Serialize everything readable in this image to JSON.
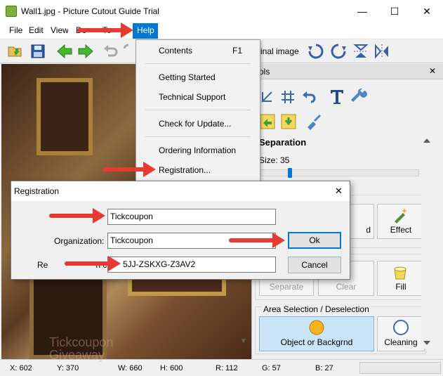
{
  "window": {
    "title": "Wall1.jpg - Picture Cutout Guide Trial",
    "minimize": "—",
    "maximize": "☐",
    "close": "✕"
  },
  "menubar": {
    "items": [
      "File",
      "Edit",
      "View",
      "Document",
      "Tools",
      "Help"
    ]
  },
  "toolbar": {
    "label": "inal image"
  },
  "tools_panel": {
    "header": "ols",
    "close": "✕",
    "separation_title": "Separation",
    "size_label": "Size: 35",
    "size_value": 35,
    "buttons": {
      "effect": "Effect",
      "d_partial": "d",
      "separate": "Separate",
      "clear": "Clear",
      "fill": "Fill"
    },
    "area_title": "Area Selection / Deselection",
    "area_buttons": {
      "object": "Object or Backgrnd",
      "cleaning": "Cleaning"
    }
  },
  "help_menu": {
    "items": [
      {
        "label": "Contents",
        "shortcut": "F1"
      },
      {
        "label": "Getting Started"
      },
      {
        "label": "Technical Support"
      },
      {
        "label": "Check for Update..."
      },
      {
        "label": "Ordering Information"
      },
      {
        "label": "Registration..."
      }
    ]
  },
  "registration": {
    "title": "Registration",
    "close": "✕",
    "name_value": "Tickcoupon",
    "org_label": "Organization:",
    "org_value": "Tickcoupon",
    "code_label_visible": "Re",
    "code_label_tail": "n code:",
    "code_value_visible": "5JJ-ZSKXG-Z3AV2",
    "ok": "Ok",
    "cancel": "Cancel"
  },
  "statusbar": {
    "x": "X: 602",
    "y": "Y: 370",
    "w": "W: 660",
    "h": "H: 600",
    "r": "R: 112",
    "g": "G: 57",
    "b": "B: 27"
  },
  "watermark": {
    "line1": "Tickcoupon",
    "line2": "Giveaway"
  },
  "colors": {
    "accent": "#0078d7",
    "arrow": "#e53b33",
    "selected": "#cce4f7"
  }
}
